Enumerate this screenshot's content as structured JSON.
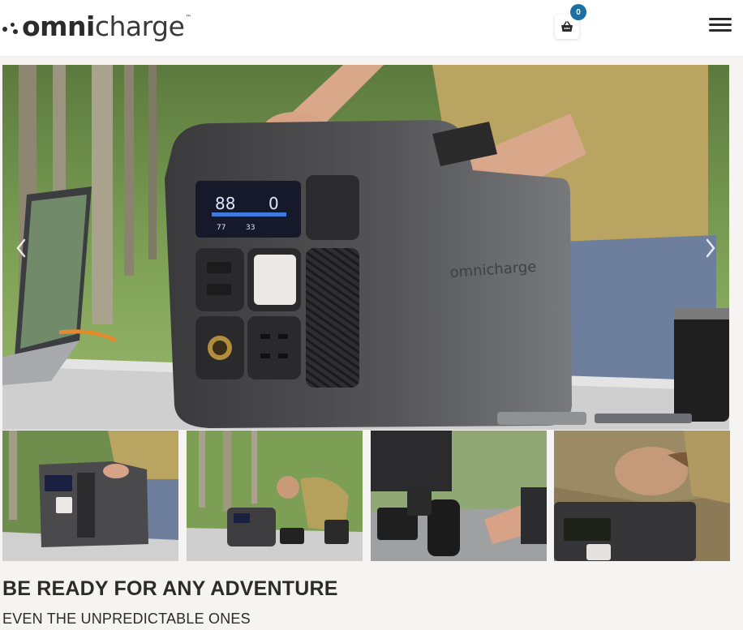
{
  "header": {
    "logo": {
      "bold": "omni",
      "light": "charge",
      "tm": "™"
    },
    "cart_count": "0"
  },
  "hero": {
    "screen": {
      "battery": "88",
      "output": "0",
      "row1": "77",
      "row2": "33"
    },
    "device_brand": "omnicharge",
    "arrows": {
      "prev": "‹",
      "next": "›"
    }
  },
  "product": {
    "headline": "BE READY FOR ANY ADVENTURE",
    "subheadline": "EVEN THE UNPREDICTABLE ONES"
  },
  "colors": {
    "accent": "#1d6fa3",
    "text": "#2b2b2b",
    "page_bg": "#f5f4f2"
  }
}
